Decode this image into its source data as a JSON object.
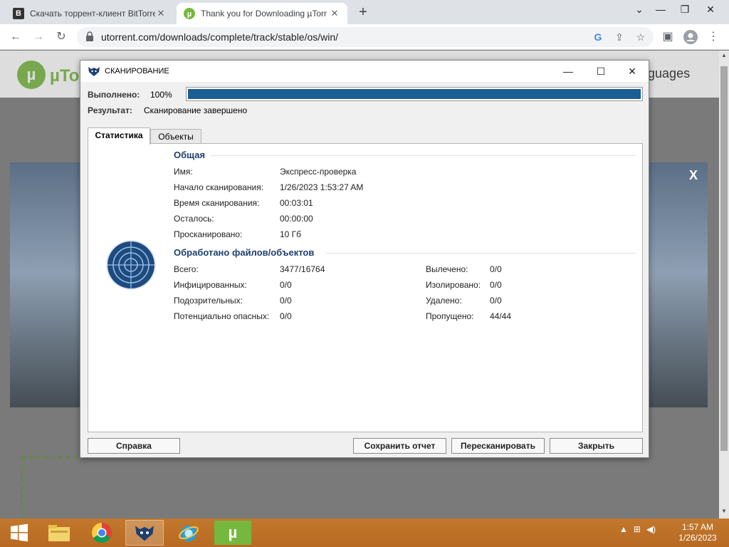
{
  "browser": {
    "tabs": [
      {
        "title": "Скачать торрент-клиент BitTorre",
        "favicon": "B",
        "active": false
      },
      {
        "title": "Thank you for Downloading µTorr",
        "favicon": "utorrent-icon",
        "active": true
      }
    ],
    "new_tab": "+",
    "url": "utorrent.com/downloads/complete/track/stable/os/win/"
  },
  "page": {
    "logo_text": "µTor",
    "languages": "anguages",
    "hero_close": "X"
  },
  "dialog": {
    "title": "СКАНИРОВАНИЕ",
    "progress_label": "Выполнено:",
    "progress_value": "100%",
    "progress_fraction": 1.0,
    "result_label": "Результат:",
    "result_value": "Сканирование завершено",
    "tabs": [
      "Статистика",
      "Объекты"
    ],
    "general": {
      "heading": "Общая",
      "rows": [
        {
          "k": "Имя:",
          "v": "Экспресс-проверка"
        },
        {
          "k": "Начало сканирования:",
          "v": "1/26/2023 1:53:27 AM"
        },
        {
          "k": "Время сканирования:",
          "v": "00:03:01"
        },
        {
          "k": "Осталось:",
          "v": "00:00:00"
        },
        {
          "k": "Просканировано:",
          "v": "10 Гб"
        }
      ]
    },
    "processed": {
      "heading": "Обработано файлов/объектов",
      "left": [
        {
          "k": "Всего:",
          "v": "3477/16764"
        },
        {
          "k": "Инфицированных:",
          "v": "0/0"
        },
        {
          "k": "Подозрительных:",
          "v": "0/0"
        },
        {
          "k": "Потенциально опасных:",
          "v": "0/0"
        }
      ],
      "right": [
        {
          "k": "Вылечено:",
          "v": "0/0"
        },
        {
          "k": "Изолировано:",
          "v": "0/0"
        },
        {
          "k": "Удалено:",
          "v": "0/0"
        },
        {
          "k": "Пропущено:",
          "v": "44/44"
        }
      ]
    },
    "buttons": {
      "help": "Справка",
      "save_report": "Сохранить отчет",
      "rescan": "Пересканировать",
      "close": "Закрыть"
    }
  },
  "taskbar": {
    "clock_time": "1:57 AM",
    "clock_date": "1/26/2023",
    "colors": {
      "taskbar": "#b86a22",
      "progress": "#1a5e94",
      "utorrent": "#76b83f"
    }
  }
}
